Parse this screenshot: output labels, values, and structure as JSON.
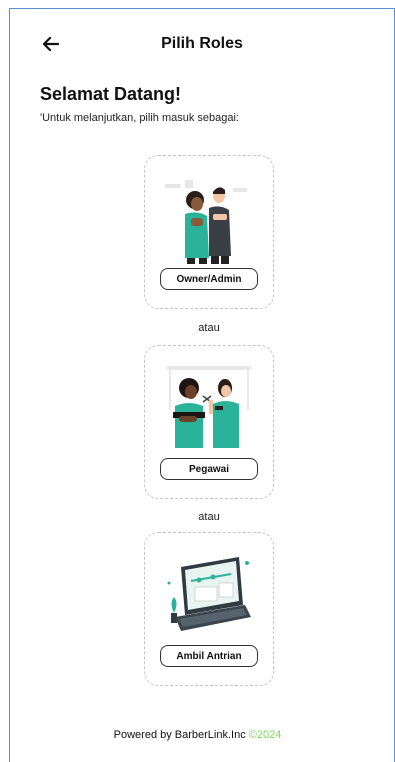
{
  "header": {
    "title": "Pilih Roles"
  },
  "intro": {
    "heading": "Selamat Datang!",
    "subtitle": "'Untuk melanjutkan, pilih masuk sebagai:"
  },
  "roles": [
    {
      "label": "Owner/Admin"
    },
    {
      "label": "Pegawai"
    },
    {
      "label": "Ambil Antrian"
    }
  ],
  "separator": "atau",
  "footer": {
    "text": "Powered by BarberLink.Inc ",
    "year": "©2024"
  },
  "colors": {
    "accent": "#2bb39a",
    "year": "#7ed957"
  },
  "icons": {
    "back": "arrow-left-icon"
  }
}
